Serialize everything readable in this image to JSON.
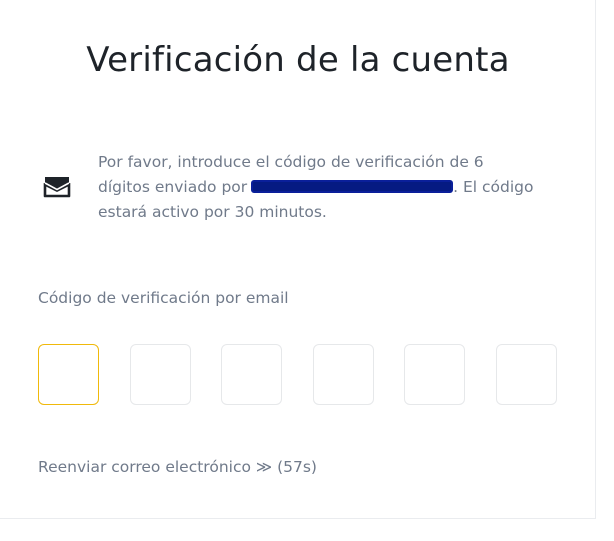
{
  "title": "Verificación de la cuenta",
  "notice": {
    "icon": "envelope-icon",
    "line1": "Por favor, introduce el código de verificación de 6",
    "line2_prefix": "dígitos enviado por",
    "line2_suffix": ". El código",
    "line3": "estará activo por 30 minutos."
  },
  "code": {
    "label": "Código de verificación por email",
    "digit_count": 6,
    "active_index": 0,
    "active_color": "#f0b90b"
  },
  "resend": {
    "label": "Reenviar correo electrónico",
    "arrow": "≫",
    "countdown": "(57s)"
  }
}
